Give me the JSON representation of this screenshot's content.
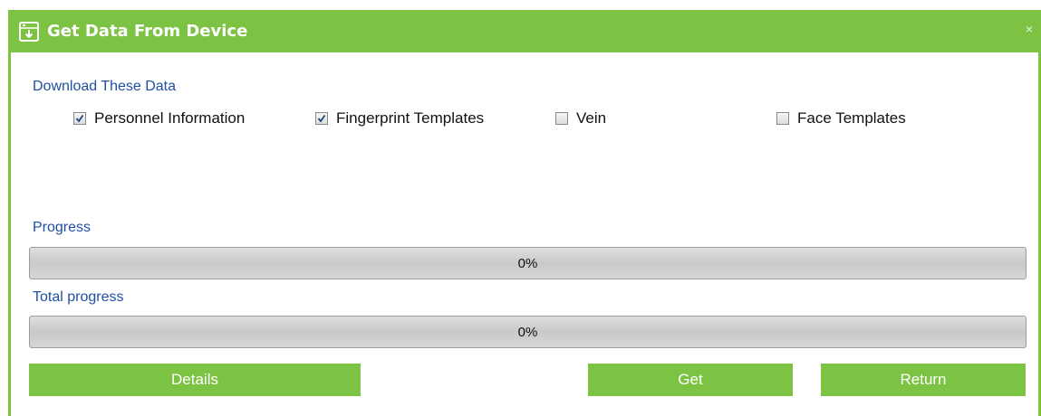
{
  "window": {
    "title": "Get Data From Device",
    "close_glyph": "×",
    "icon": "device-download-icon"
  },
  "download_section": {
    "label": "Download These Data",
    "options": [
      {
        "label": "Personnel Information",
        "checked": true
      },
      {
        "label": "Fingerprint Templates",
        "checked": true
      },
      {
        "label": "Vein",
        "checked": false
      },
      {
        "label": "Face Templates",
        "checked": false
      }
    ]
  },
  "progress": {
    "label": "Progress",
    "value_text": "0%",
    "value": 0
  },
  "total_progress": {
    "label": "Total progress",
    "value_text": "0%",
    "value": 0
  },
  "buttons": {
    "details": "Details",
    "get": "Get",
    "return": "Return"
  },
  "colors": {
    "accent": "#7cc243",
    "label_blue": "#1f4fa3"
  }
}
